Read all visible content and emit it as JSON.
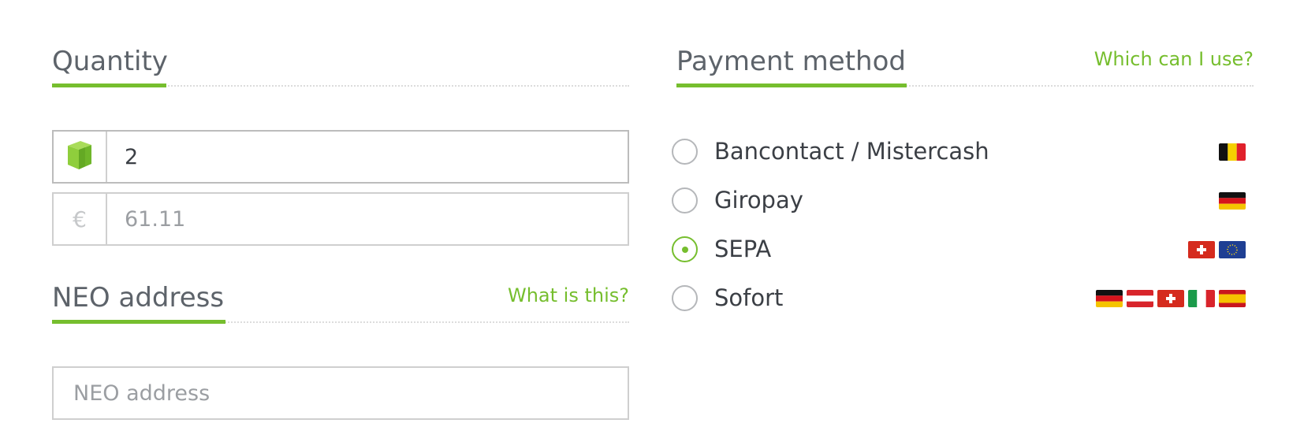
{
  "quantity": {
    "title": "Quantity",
    "amount": "2",
    "price": "61.11",
    "currency_symbol": "€",
    "neo_icon": "neo-logo-icon"
  },
  "neo_address": {
    "title": "NEO address",
    "help_link": "What is this?",
    "placeholder": "NEO address"
  },
  "payment": {
    "title": "Payment method",
    "help_link": "Which can I use?",
    "methods": [
      {
        "label": "Bancontact / Mistercash",
        "selected": false,
        "flags": [
          "belgium-flag-icon"
        ]
      },
      {
        "label": "Giropay",
        "selected": false,
        "flags": [
          "germany-flag-icon"
        ]
      },
      {
        "label": "SEPA",
        "selected": true,
        "flags": [
          "switzerland-flag-icon",
          "eu-flag-icon"
        ]
      },
      {
        "label": "Sofort",
        "selected": false,
        "flags": [
          "germany-flag-icon",
          "austria-flag-icon",
          "switzerland-flag-icon",
          "italy-flag-icon",
          "spain-flag-icon"
        ]
      }
    ]
  },
  "colors": {
    "accent": "#76be2e",
    "heading": "#5d636a",
    "text": "#3b3f45",
    "muted": "#9b9ea2",
    "border": "#cfcfcf"
  }
}
